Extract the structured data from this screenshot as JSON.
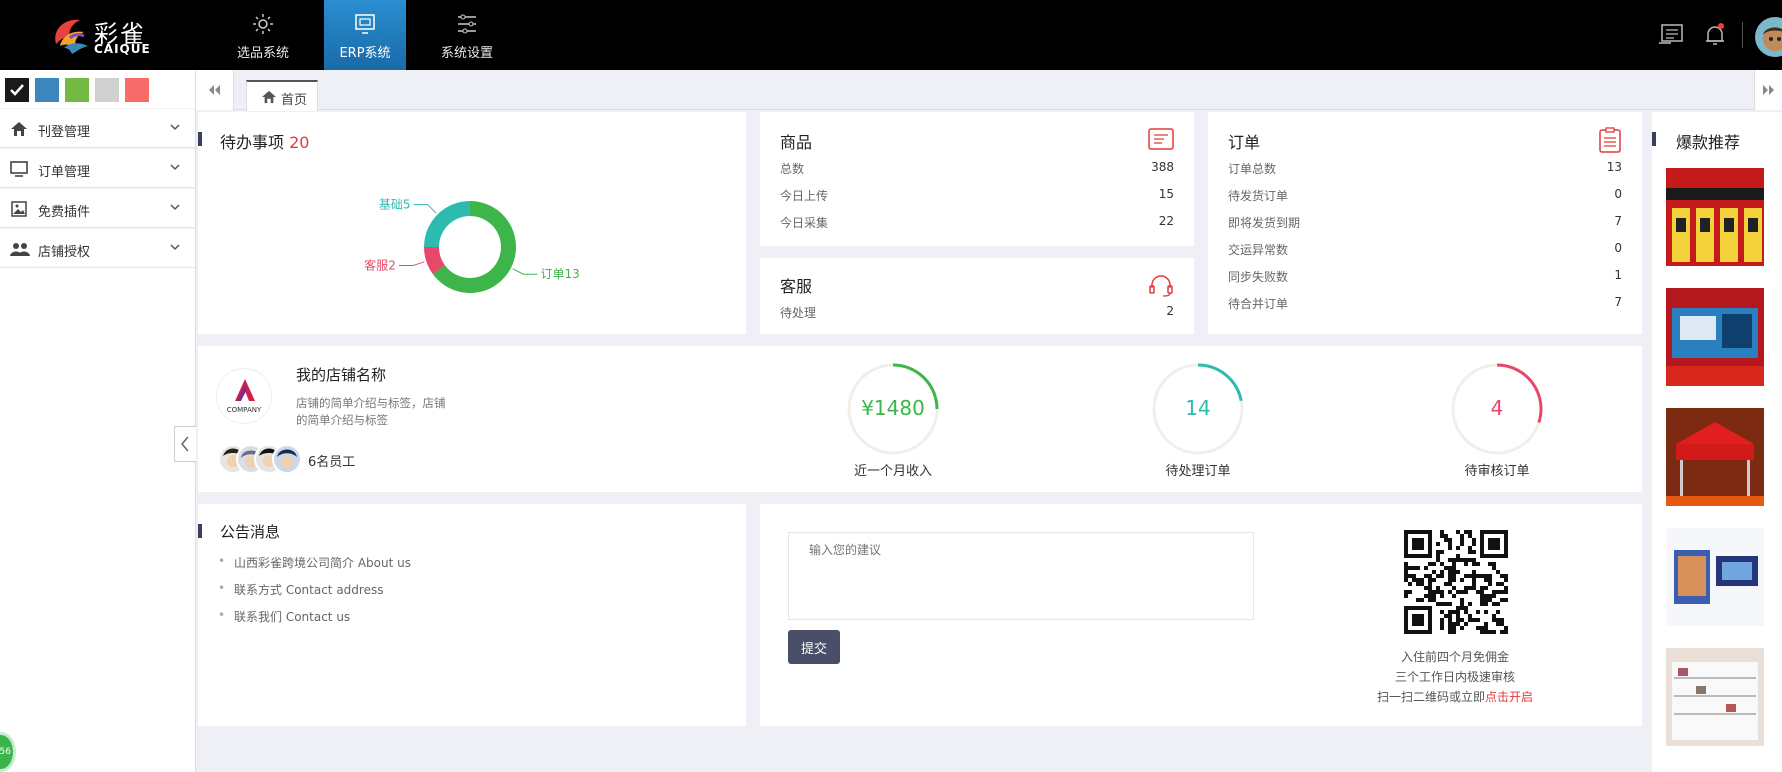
{
  "header": {
    "logo_cn": "彩雀",
    "logo_en": "CAIQUE",
    "nav": [
      {
        "label": "选品系统",
        "icon": "gear-icon"
      },
      {
        "label": "ERP系统",
        "icon": "monitor-icon",
        "active": true
      },
      {
        "label": "系统设置",
        "icon": "sliders-icon"
      }
    ]
  },
  "sidebar": {
    "swatches": [
      "#1a1a1a",
      "#3a87bd",
      "#75b843",
      "#d1d1d1",
      "#f76b6b"
    ],
    "items": [
      {
        "label": "刊登管理",
        "icon": "home-icon"
      },
      {
        "label": "订单管理",
        "icon": "monitor-icon"
      },
      {
        "label": "免费插件",
        "icon": "image-icon"
      },
      {
        "label": "店铺授权",
        "icon": "users-icon"
      }
    ],
    "badge": "56"
  },
  "tabs": {
    "home": "首页"
  },
  "todo": {
    "title": "待办事项",
    "count": "20",
    "chart_data": {
      "type": "pie",
      "categories": [
        "订单13",
        "客服2",
        "基础5"
      ],
      "values": [
        13,
        2,
        5
      ],
      "colors": [
        "#3eb54a",
        "#e8496a",
        "#2dbbaf"
      ]
    }
  },
  "goods": {
    "title": "商品",
    "rows": [
      {
        "label": "总数",
        "value": "388"
      },
      {
        "label": "今日上传",
        "value": "15"
      },
      {
        "label": "今日采集",
        "value": "22"
      }
    ]
  },
  "service": {
    "title": "客服",
    "rows": [
      {
        "label": "待处理",
        "value": "2"
      }
    ]
  },
  "orders": {
    "title": "订单",
    "rows": [
      {
        "label": "订单总数",
        "value": "13"
      },
      {
        "label": "待发货订单",
        "value": "0"
      },
      {
        "label": "即将发货到期",
        "value": "7"
      },
      {
        "label": "交运异常数",
        "value": "0"
      },
      {
        "label": "同步失败数",
        "value": "1"
      },
      {
        "label": "待合并订单",
        "value": "7"
      }
    ]
  },
  "shop": {
    "name": "我的店铺名称",
    "desc1": "店铺的简单介绍与标签，店铺",
    "desc2": "的简单介绍与标签",
    "staff": "6名员工",
    "logo_text": "COMPANY",
    "metrics": [
      {
        "value": "¥1480",
        "caption": "近一个月收入",
        "color": "#3eb54a",
        "fraction": 0.25
      },
      {
        "value": "14",
        "caption": "待处理订单",
        "color": "#2dbbaf",
        "fraction": 0.22
      },
      {
        "value": "4",
        "caption": "待审核订单",
        "color": "#e8496a",
        "fraction": 0.3
      }
    ]
  },
  "notice": {
    "title": "公告消息",
    "items": [
      "山西彩雀跨境公司简介 About us",
      "联系方式 Contact address",
      "联系我们 Contact us"
    ]
  },
  "feedback": {
    "placeholder": "输入您的建议",
    "submit": "提交",
    "qr_line1": "入住前四个月免佣金",
    "qr_line2": "三个工作日内极速审核",
    "qr_line3": "扫一扫二维码或立即",
    "qr_link": "点击开启"
  },
  "recommend": {
    "title": "爆款推荐"
  }
}
